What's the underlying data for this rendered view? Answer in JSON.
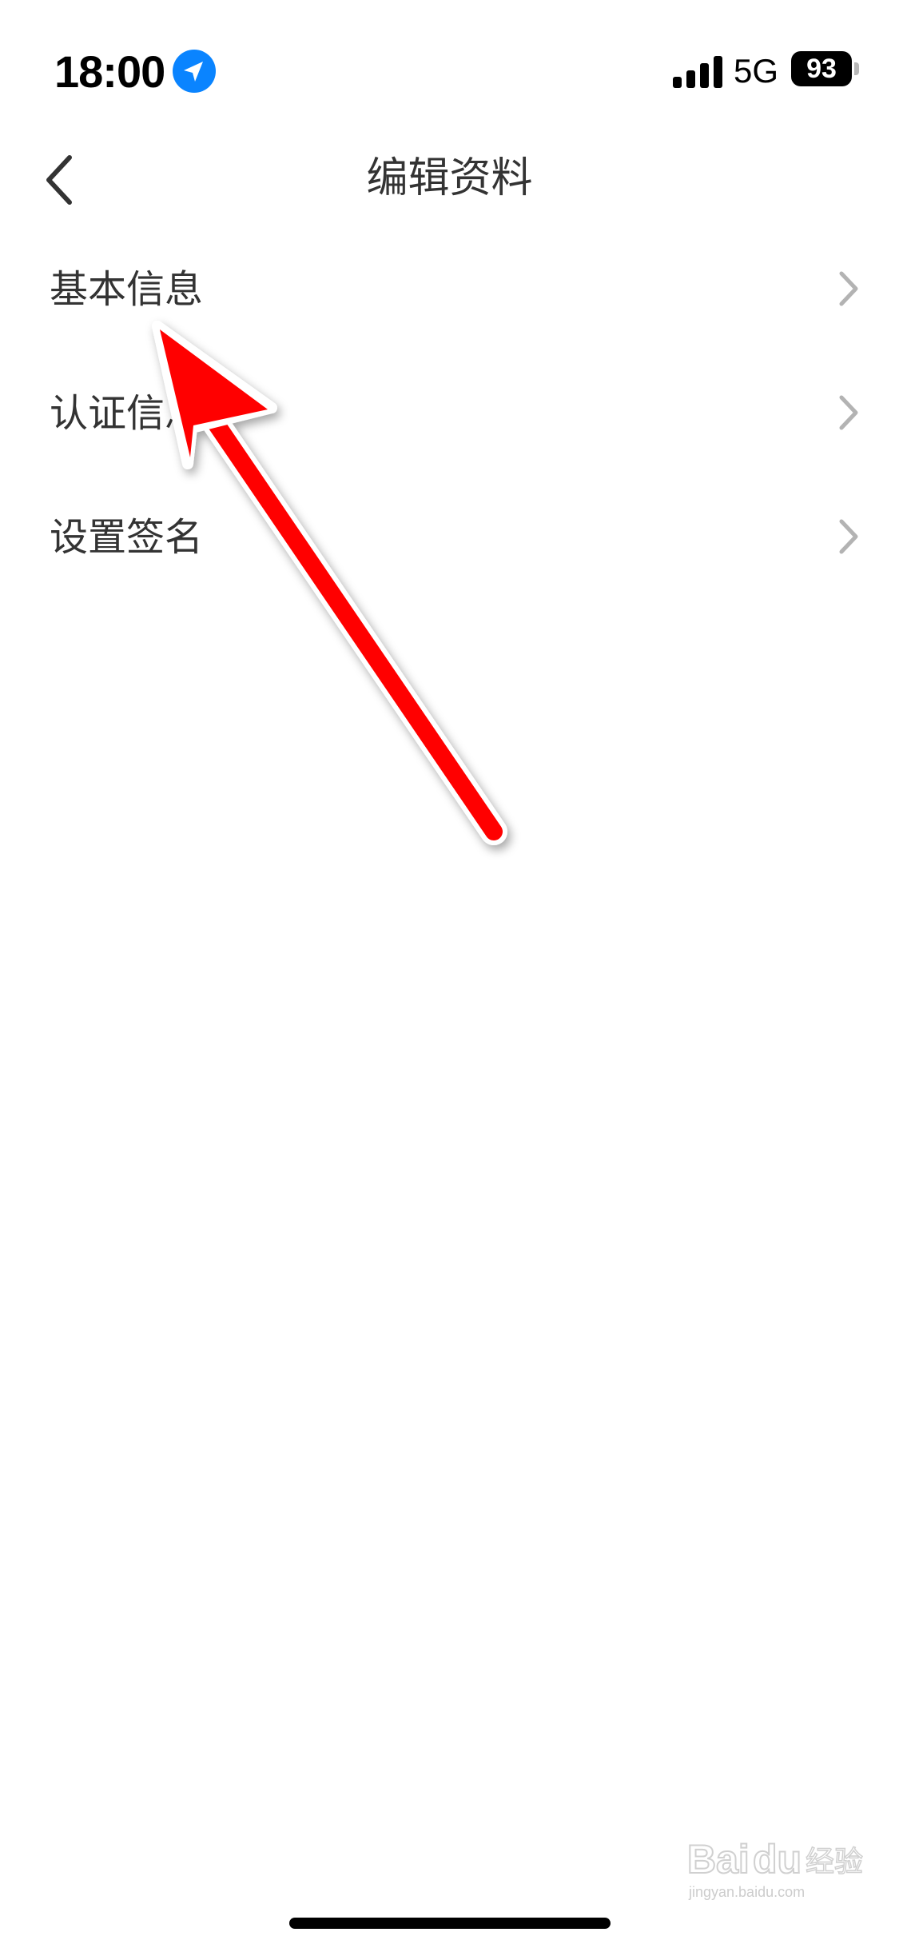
{
  "status_bar": {
    "time": "18:00",
    "network": "5G",
    "battery_level": "93",
    "location_icon": "location-arrow-icon",
    "signal_icon": "cellular-signal-icon"
  },
  "nav": {
    "title": "编辑资料",
    "back_icon": "chevron-left-icon"
  },
  "menu": {
    "items": [
      {
        "label": "基本信息",
        "icon": "chevron-right-icon"
      },
      {
        "label": "认证信息",
        "icon": "chevron-right-icon"
      },
      {
        "label": "设置签名",
        "icon": "chevron-right-icon"
      }
    ]
  },
  "annotation": {
    "color": "#ff0000"
  },
  "watermark": {
    "text": "Baidu经验",
    "subtext": "jingyan.baidu.com"
  }
}
